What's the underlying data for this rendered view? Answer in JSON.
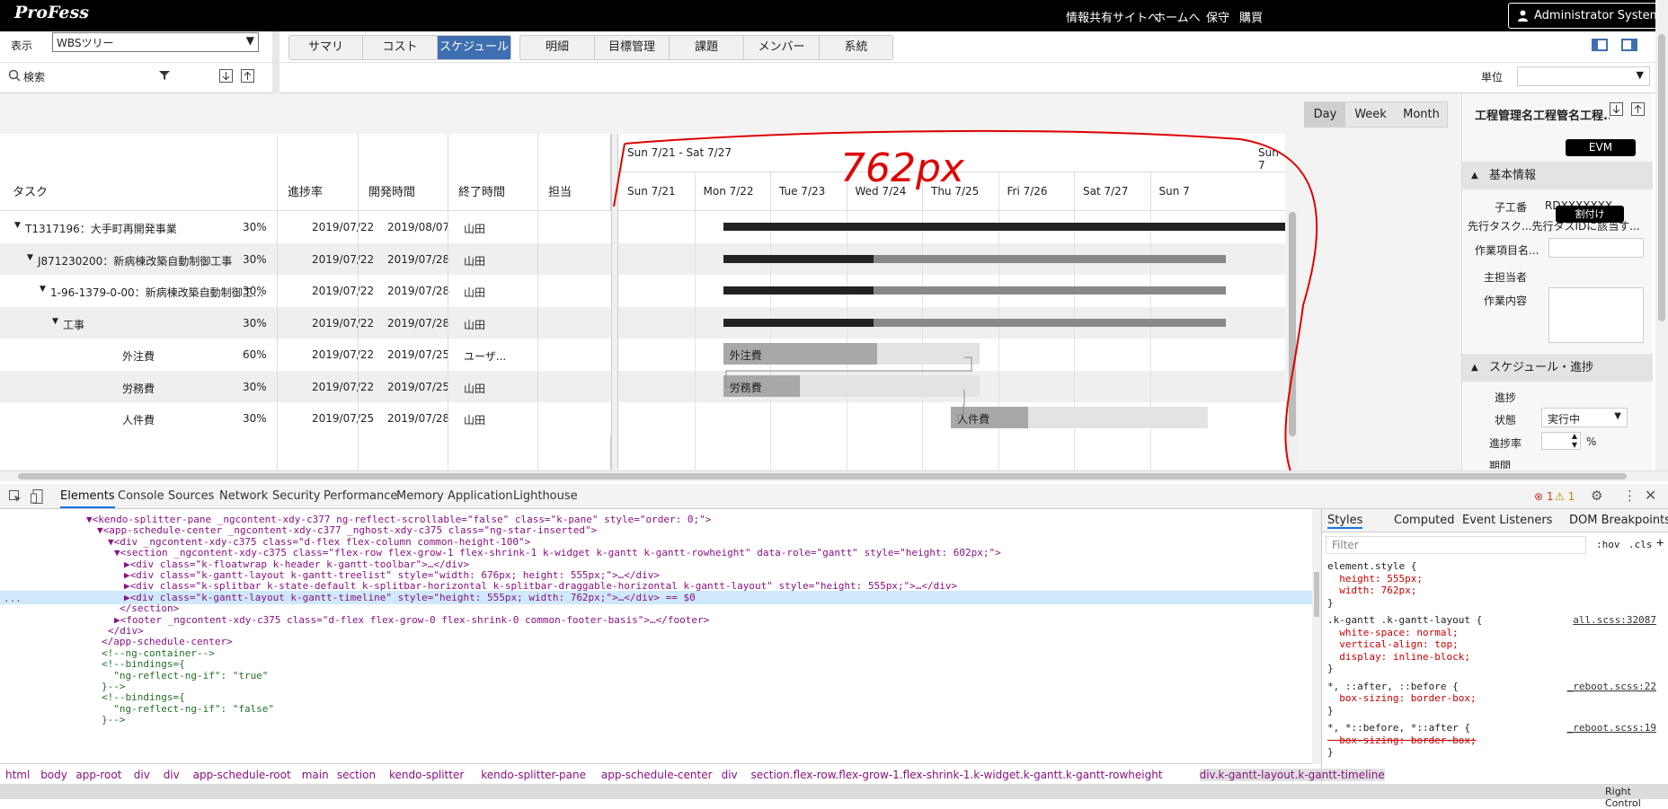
{
  "topbar": {
    "logo": "ProFess",
    "links": [
      "情報共有サイトへ",
      "ホームへ",
      "保守",
      "購買"
    ],
    "user": "Administrator System"
  },
  "toolbar": {
    "view_label": "表示",
    "view_value": "WBSツリー",
    "tabs1": [
      "サマリ",
      "コスト",
      "スケジュール"
    ],
    "active_tab": "スケジュール",
    "tabs2": [
      "明細",
      "目標管理",
      "課題",
      "メンバー",
      "系統"
    ],
    "search_placeholder": "検索",
    "unit_label": "単位"
  },
  "gantt": {
    "view_buttons": [
      "Day",
      "Week",
      "Month"
    ],
    "active_view": "Day",
    "columns": [
      "タスク",
      "進捗率",
      "開発時間",
      "終了時間",
      "担当"
    ],
    "rows": [
      {
        "task": "T1317196：大手町再開発事業",
        "progress": "30%",
        "start": "2019/07/22",
        "end": "2019/08/07",
        "owner": "山田",
        "level": 0,
        "expand": true,
        "pct": 0.8
      },
      {
        "task": "J871230200：新病棟改築自動制御工事",
        "progress": "30%",
        "start": "2019/07/22",
        "end": "2019/07/28",
        "owner": "山田",
        "level": 1,
        "expand": true,
        "pct": 0.3
      },
      {
        "task": "1-96-1379-0-00：新病棟改築自動制御工...",
        "progress": "30%",
        "start": "2019/07/22",
        "end": "2019/07/28",
        "owner": "山田",
        "level": 2,
        "expand": true,
        "pct": 0.3
      },
      {
        "task": "工事",
        "progress": "30%",
        "start": "2019/07/22",
        "end": "2019/07/28",
        "owner": "山田",
        "level": 3,
        "expand": true,
        "pct": 0.3
      },
      {
        "task": "外注費",
        "progress": "60%",
        "start": "2019/07/22",
        "end": "2019/07/25",
        "owner": "ユーザ...",
        "level": 4,
        "expand": false,
        "pct": 0.6
      },
      {
        "task": "労務費",
        "progress": "30%",
        "start": "2019/07/22",
        "end": "2019/07/25",
        "owner": "山田",
        "level": 4,
        "expand": false,
        "pct": 0.3
      },
      {
        "task": "人件費",
        "progress": "30%",
        "start": "2019/07/25",
        "end": "2019/07/28",
        "owner": "山田",
        "level": 4,
        "expand": false,
        "pct": 0.3
      }
    ],
    "week_header": "Sun 7/21 - Sat 7/27",
    "week_header_next": "Sun 7",
    "days": [
      "Sun 7/21",
      "Mon 7/22",
      "Tue 7/23",
      "Wed 7/24",
      "Thu 7/25",
      "Fri 7/26",
      "Sat 7/27",
      "Sun 7"
    ],
    "annotation": "762px"
  },
  "right_panel": {
    "title": "工程管理名工程管名工程...",
    "evm_button": "EVM",
    "basic_section": "基本情報",
    "child_no_label": "子工番",
    "child_no_value": "RDXXXXXXX",
    "assign_button": "割付け",
    "pre_task": "先行タスク...先行タスIDに該当す...",
    "item_name_label": "作業項目名...",
    "main_owner_label": "主担当者",
    "content_label": "作業内容",
    "schedule_section": "スケジュール・進捗",
    "progress_label": "進捗",
    "state_label": "状態",
    "state_value": "実行中",
    "rate_label": "進捗率",
    "rate_unit": "%",
    "period_label": "期間"
  },
  "devtools": {
    "tabs": [
      "Elements",
      "Console",
      "Sources",
      "Network",
      "Security",
      "Performance",
      "Memory",
      "Application",
      "Lighthouse"
    ],
    "active": "Elements",
    "errors": "1",
    "warnings": "1",
    "code_lines": [
      "▼<kendo-splitter-pane _ngcontent-xdy-c377 ng-reflect-scrollable=\"false\" class=\"k-pane\" style=\"order: 0;\">",
      "▼<app-schedule-center _ngcontent-xdy-c377 _nghost-xdy-c375 class=\"ng-star-inserted\">",
      "▼<div _ngcontent-xdy-c375 class=\"d-flex flex-column common-height-100\">",
      "▼<section _ngcontent-xdy-c375 class=\"flex-row flex-grow-1 flex-shrink-1 k-widget k-gantt k-gantt-rowheight\" data-role=\"gantt\" style=\"height: 602px;\">",
      "▶<div class=\"k-floatwrap k-header k-gantt-toolbar\">…</div>",
      "▶<div class=\"k-gantt-layout k-gantt-treelist\" style=\"width: 676px; height: 555px;\">…</div>",
      "▶<div class=\"k-splitbar k-state-default k-splitbar-horizontal k-splitbar-draggable-horizontal k-gantt-layout\" style=\"height: 555px;\">…</div>",
      "▶<div class=\"k-gantt-layout k-gantt-timeline\" style=\"height: 555px; width: 762px;\">…</div> == $0",
      "</section>",
      "▶<footer _ngcontent-xdy-c375 class=\"d-flex flex-grow-0 flex-shrink-0 common-footer-basis\">…</footer>",
      "</div>",
      "</app-schedule-center>",
      "<!--ng-container-->",
      "<!--bindings={",
      "  \"ng-reflect-ng-if\": \"true\"",
      "}-->",
      "<!--bindings={",
      "  \"ng-reflect-ng-if\": \"false\"",
      "}-->"
    ],
    "breadcrumbs": [
      "html",
      "body",
      "app-root",
      "div",
      "div",
      "app-schedule-root",
      "main",
      "section",
      "kendo-splitter",
      "kendo-splitter-pane",
      "app-schedule-center",
      "div",
      "section.flex-row.flex-grow-1.flex-shrink-1.k-widget.k-gantt.k-gantt-rowheight",
      "div.k-gantt-layout.k-gantt-timeline"
    ],
    "styles_tabs": [
      "Styles",
      "Computed",
      "Event Listeners",
      "DOM Breakpoints"
    ],
    "filter_placeholder": "Filter",
    "hov": ":hov",
    "cls": ".cls",
    "style_lines": [
      "element.style {",
      "  height: 555px;",
      "  width: 762px;",
      "}",
      ".k-gantt .k-gantt-layout {",
      "  white-space: normal;",
      "  vertical-align: top;",
      "  display: inline-block;",
      "}",
      "*, ::after, ::before {",
      "  box-sizing: border-box;",
      "}",
      "*, *::before, *::after {",
      "  box-sizing: border-box;",
      "}"
    ],
    "style_sources": [
      "all.scss:32087",
      "_reboot.scss:22",
      "_reboot.scss:19"
    ],
    "status_text": "Right Control"
  }
}
